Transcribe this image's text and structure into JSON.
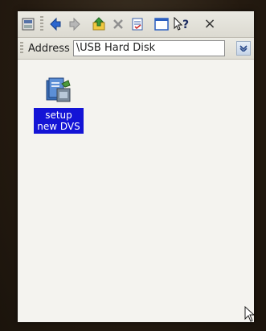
{
  "toolbar": {
    "buttons": [
      {
        "name": "view-icon"
      },
      {
        "name": "back-arrow-icon"
      },
      {
        "name": "forward-arrow-icon"
      },
      {
        "name": "up-folder-icon"
      },
      {
        "name": "delete-icon"
      },
      {
        "name": "properties-icon"
      },
      {
        "name": "window-icon"
      },
      {
        "name": "help-icon",
        "text": "?"
      },
      {
        "name": "close-icon",
        "text": "×"
      }
    ]
  },
  "address": {
    "label": "Address",
    "value": "\\USB Hard Disk"
  },
  "files": [
    {
      "label": "setup new DVS",
      "selected": true
    }
  ],
  "colors": {
    "selection": "#1414d6",
    "toolbar": "#e4e2da",
    "background": "#f4f3ef"
  }
}
